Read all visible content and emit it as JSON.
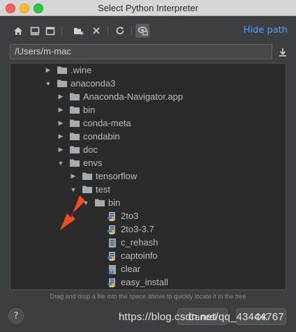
{
  "window": {
    "title": "Select Python Interpreter"
  },
  "toolbar": {
    "icons": [
      "home-icon",
      "desktop-icon",
      "project-icon",
      "new-folder-icon",
      "delete-icon",
      "refresh-icon",
      "show-hidden-icon"
    ],
    "hide_path_label": "Hide path"
  },
  "path": {
    "value": "/Users/m-mac"
  },
  "tree": {
    "rows": [
      {
        "label": ".wine",
        "depth": 0,
        "state": "collapsed",
        "kind": "folder"
      },
      {
        "label": "anaconda3",
        "depth": 0,
        "state": "expanded",
        "kind": "folder"
      },
      {
        "label": "Anaconda-Navigator.app",
        "depth": 1,
        "state": "collapsed",
        "kind": "folder"
      },
      {
        "label": "bin",
        "depth": 1,
        "state": "collapsed",
        "kind": "folder"
      },
      {
        "label": "conda-meta",
        "depth": 1,
        "state": "collapsed",
        "kind": "folder"
      },
      {
        "label": "condabin",
        "depth": 1,
        "state": "collapsed",
        "kind": "folder"
      },
      {
        "label": "doc",
        "depth": 1,
        "state": "collapsed",
        "kind": "folder"
      },
      {
        "label": "envs",
        "depth": 1,
        "state": "expanded",
        "kind": "folder"
      },
      {
        "label": "tensorflow",
        "depth": 2,
        "state": "collapsed",
        "kind": "folder"
      },
      {
        "label": "test",
        "depth": 2,
        "state": "expanded",
        "kind": "folder"
      },
      {
        "label": "bin",
        "depth": 3,
        "state": "expanded",
        "kind": "folder"
      },
      {
        "label": "2to3",
        "depth": 4,
        "state": "leaf",
        "kind": "python"
      },
      {
        "label": "2to3-3.7",
        "depth": 4,
        "state": "leaf",
        "kind": "python"
      },
      {
        "label": "c_rehash",
        "depth": 4,
        "state": "leaf",
        "kind": "text"
      },
      {
        "label": "captoinfo",
        "depth": 4,
        "state": "leaf",
        "kind": "python"
      },
      {
        "label": "clear",
        "depth": 4,
        "state": "leaf",
        "kind": "unknown"
      },
      {
        "label": "easy_install",
        "depth": 4,
        "state": "leaf",
        "kind": "python"
      }
    ]
  },
  "hint": "Drag and drop a file into the space above to quickly locate it in the tree",
  "buttons": {
    "help": "?",
    "cancel": "Cancel",
    "ok": "OK"
  },
  "watermark": "https://blog.csdn.net/qq_43444767",
  "colors": {
    "accent": "#589df6",
    "arrow": "#ff4a1c",
    "folder": "#a6abb0"
  }
}
